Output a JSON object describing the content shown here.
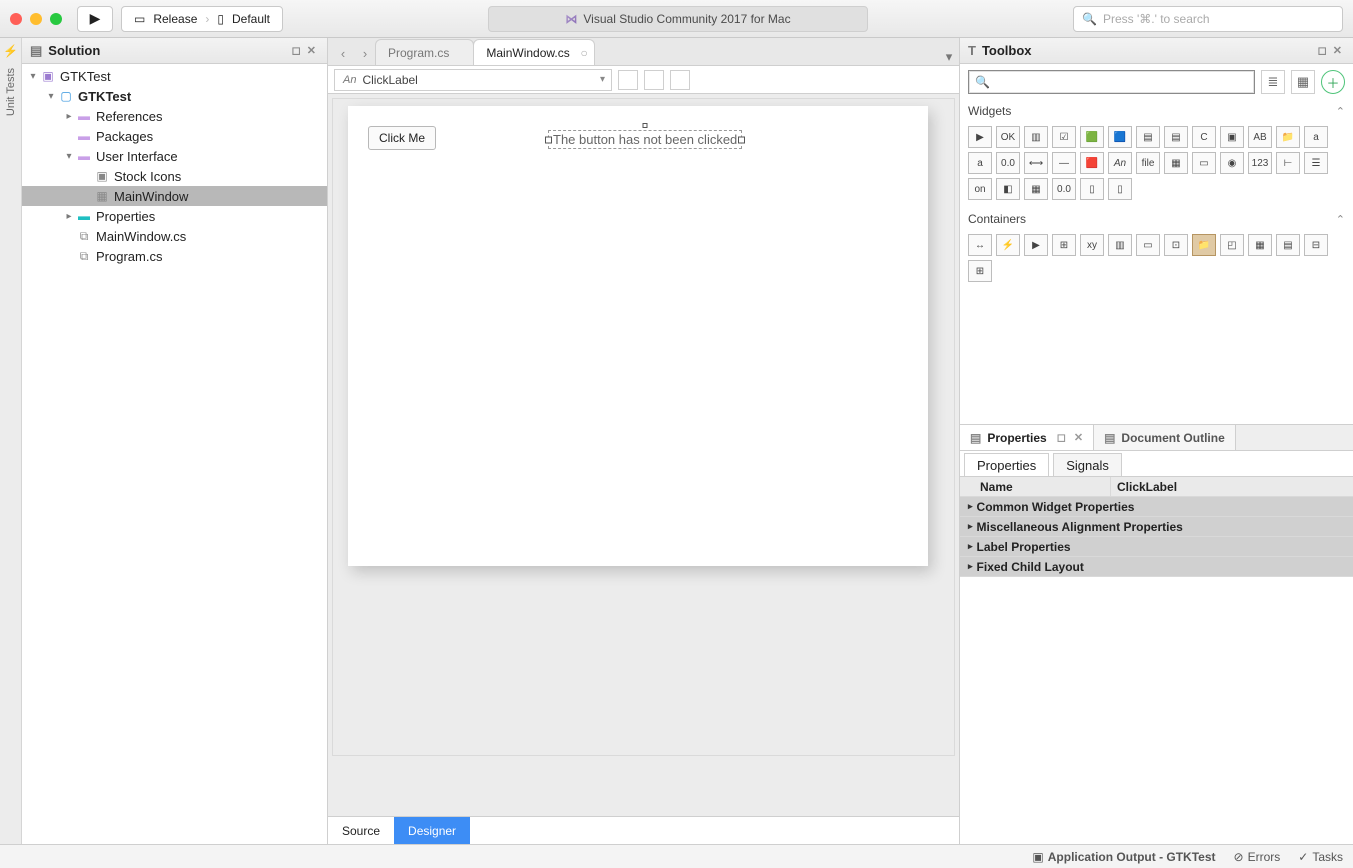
{
  "titlebar": {
    "run_config": "Release",
    "run_target": "Default",
    "app_title": "Visual Studio Community 2017 for Mac",
    "search_placeholder": "Press '⌘.' to search"
  },
  "left_gutter": {
    "unit_tests": "Unit Tests"
  },
  "solution_panel": {
    "title": "Solution",
    "tree": {
      "root": "GTKTest",
      "project": "GTKTest",
      "references": "References",
      "packages": "Packages",
      "ui_folder": "User Interface",
      "stock_icons": "Stock Icons",
      "mainwindow": "MainWindow",
      "properties": "Properties",
      "mainwindow_cs": "MainWindow.cs",
      "program_cs": "Program.cs"
    }
  },
  "editor": {
    "tabs": {
      "program": "Program.cs",
      "mainwindow": "MainWindow.cs"
    },
    "breadcrumb": "ClickLabel",
    "canvas": {
      "button_text": "Click Me",
      "label_text": "The button has not been clicked"
    },
    "view_switch": {
      "source": "Source",
      "designer": "Designer"
    }
  },
  "toolbox": {
    "title": "Toolbox",
    "widgets_title": "Widgets",
    "containers_title": "Containers"
  },
  "properties": {
    "tab_properties": "Properties",
    "tab_outline": "Document Outline",
    "subtab_properties": "Properties",
    "subtab_signals": "Signals",
    "header_name": "Name",
    "name_value": "ClickLabel",
    "cats": {
      "common": "Common Widget Properties",
      "misc": "Miscellaneous Alignment Properties",
      "label": "Label Properties",
      "fixed": "Fixed Child Layout"
    }
  },
  "status": {
    "app_output": "Application Output - GTKTest",
    "errors": "Errors",
    "tasks": "Tasks"
  }
}
